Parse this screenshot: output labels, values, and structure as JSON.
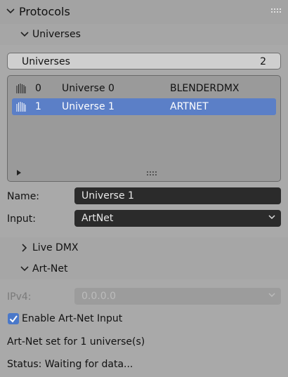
{
  "protocols": {
    "title": "Protocols"
  },
  "universes_section": {
    "title": "Universes"
  },
  "universes_count_bar": {
    "label": "Universes",
    "count": "2"
  },
  "universe_list": {
    "rows": [
      {
        "index": "0",
        "name": "Universe 0",
        "protocol": "BLENDERDMX",
        "selected": false
      },
      {
        "index": "1",
        "name": "Universe 1",
        "protocol": "ARTNET",
        "selected": true
      }
    ]
  },
  "properties": {
    "name_label": "Name:",
    "name_value": "Universe 1",
    "input_label": "Input:",
    "input_value": "ArtNet"
  },
  "live_dmx": {
    "title": "Live DMX"
  },
  "artnet": {
    "title": "Art-Net",
    "ipv4_label": "IPv4:",
    "ipv4_value": "0.0.0.0",
    "enable_label": "Enable Art-Net Input",
    "enable_checked": true,
    "set_message": "Art-Net set for 1 universe(s)",
    "status_message": "Status: Waiting for data..."
  },
  "colors": {
    "panel_bg": "#a9a9a9",
    "header_bg": "#a3a3a3",
    "selected_row": "#5b7fc7",
    "field_bg": "#2b2b2b",
    "checkbox_accent": "#4a78c9"
  }
}
